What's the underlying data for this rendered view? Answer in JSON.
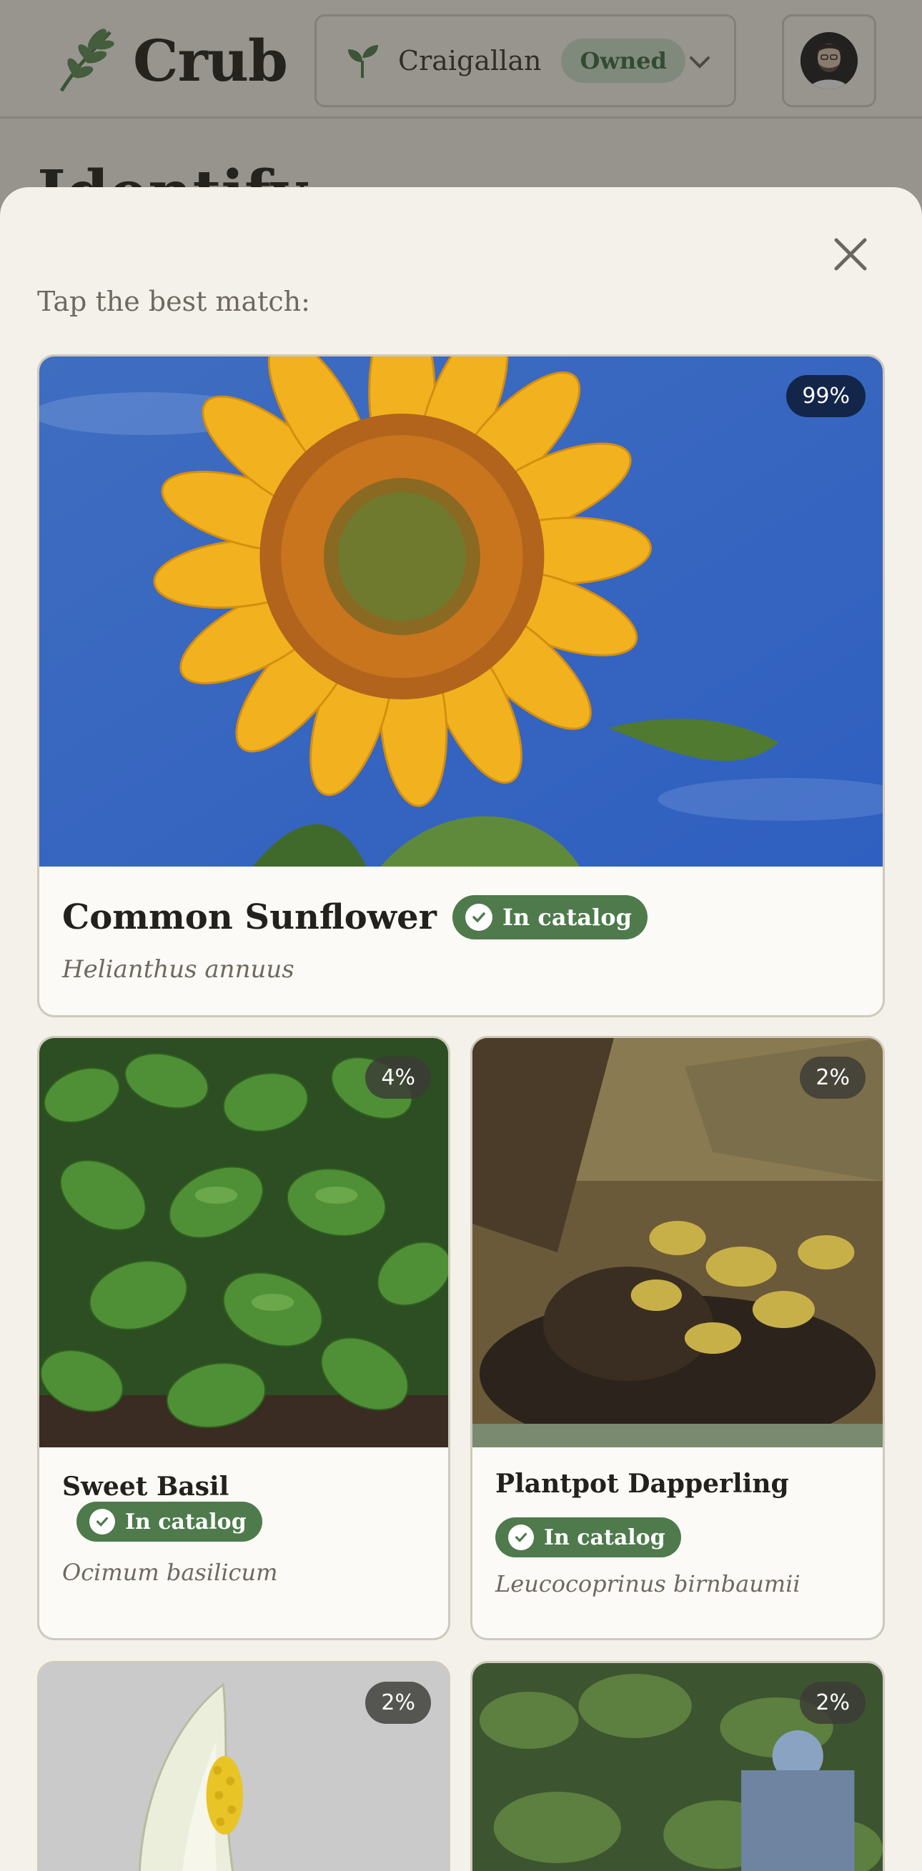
{
  "header": {
    "brand": "Crub",
    "garden": {
      "name": "Craigallan",
      "badge": "Owned"
    },
    "page_title": "Identify"
  },
  "sheet": {
    "prompt": "Tap the best match:",
    "matches": [
      {
        "name": "Common Sunflower",
        "scientific": "Helianthus annuus",
        "confidence": "99%",
        "catalog": "In catalog",
        "image": "sunflower-photo"
      },
      {
        "name": "Sweet Basil",
        "scientific": "Ocimum basilicum",
        "confidence": "4%",
        "catalog": "In catalog",
        "image": "basil-photo"
      },
      {
        "name": "Plantpot Dapperling",
        "scientific": "Leucocoprinus birnbaumii",
        "confidence": "2%",
        "catalog": "In catalog",
        "image": "mushroom-pot-photo"
      },
      {
        "name": "",
        "scientific": "",
        "confidence": "2%",
        "catalog": "",
        "image": "peace-lily-photo"
      },
      {
        "name": "",
        "scientific": "",
        "confidence": "2%",
        "catalog": "",
        "image": "potted-plant-photo"
      }
    ]
  },
  "colors": {
    "accent_green": "#4e7a4c",
    "top_match_badge": "#13264a",
    "sheet_bg": "#f4f1ea"
  }
}
